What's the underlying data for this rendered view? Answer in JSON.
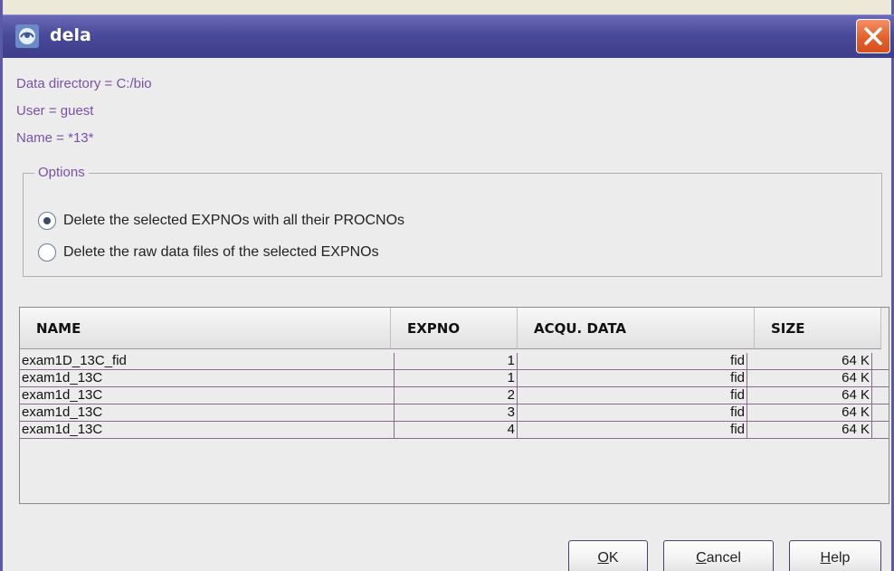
{
  "window": {
    "title": "dela",
    "close_symbol": "✕",
    "icon": "app-logo-icon"
  },
  "info": {
    "data_directory": "Data directory = C:/bio",
    "user": "User = guest",
    "name": "Name = *13*"
  },
  "options": {
    "legend": "Options",
    "items": [
      {
        "label": "Delete the selected EXPNOs with all their PROCNOs",
        "checked": true
      },
      {
        "label": "Delete the raw data files of the selected EXPNOs",
        "checked": false
      }
    ]
  },
  "table": {
    "columns": [
      "NAME",
      "EXPNO",
      "ACQU. DATA",
      "SIZE"
    ],
    "rows": [
      [
        "exam1D_13C_fid",
        "1",
        "fid",
        "64 K"
      ],
      [
        "exam1d_13C",
        "1",
        "fid",
        "64 K"
      ],
      [
        "exam1d_13C",
        "2",
        "fid",
        "64 K"
      ],
      [
        "exam1d_13C",
        "3",
        "fid",
        "64 K"
      ],
      [
        "exam1d_13C",
        "4",
        "fid",
        "64 K"
      ]
    ]
  },
  "buttons": {
    "ok": {
      "mnemonic": "O",
      "rest": "K"
    },
    "cancel": {
      "mnemonic": "C",
      "rest": "ancel"
    },
    "help": {
      "mnemonic": "H",
      "rest": "elp"
    }
  },
  "colors": {
    "title_bar": "#4a4a9a",
    "info_text": "#7a50a8",
    "close_button": "#e3602a",
    "dialog_background": "#ececec"
  }
}
